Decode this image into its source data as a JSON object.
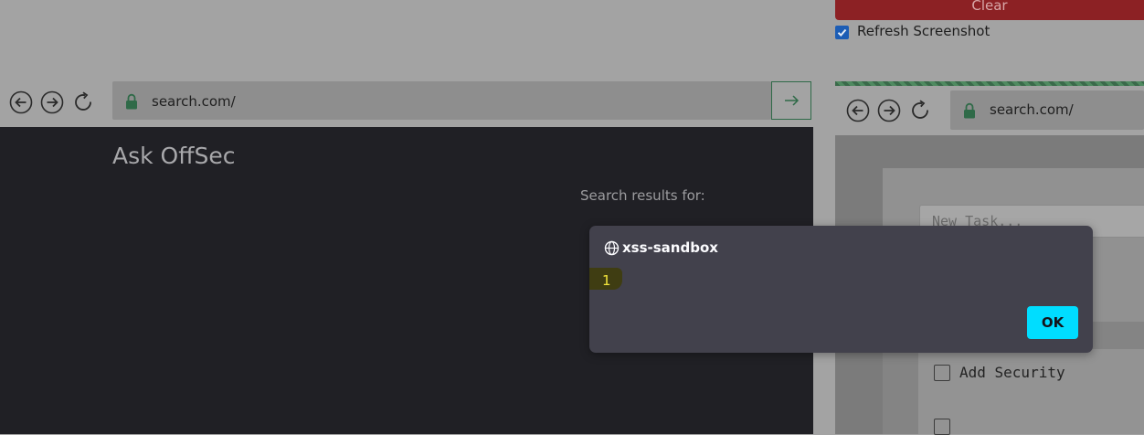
{
  "right_panel": {
    "clear_label": "Clear",
    "refresh_label": "Refresh Screenshot",
    "refresh_checked": true
  },
  "left_browser": {
    "url": "search.com/",
    "icons": [
      "back-icon",
      "forward-icon",
      "reload-icon",
      "lock-icon",
      "go-arrow-icon"
    ]
  },
  "left_page": {
    "title": "Ask OffSec",
    "results_label": "Search results for:"
  },
  "right_browser": {
    "url": "search.com/"
  },
  "right_page": {
    "task_placeholder": "New Task...",
    "tasks": [
      {
        "label": "Add Security",
        "checked": false
      },
      {
        "label": "",
        "checked": false
      }
    ]
  },
  "dialog": {
    "origin": "xss-sandbox",
    "message": "1",
    "ok_label": "OK"
  },
  "colors": {
    "dialog_bg": "#42414c",
    "ok_button": "#00ddff",
    "message_text": "#f2e43b",
    "clear_button": "#8c2124",
    "checkbox_accent": "#1c5db5",
    "lock_green": "#2f6a48"
  }
}
